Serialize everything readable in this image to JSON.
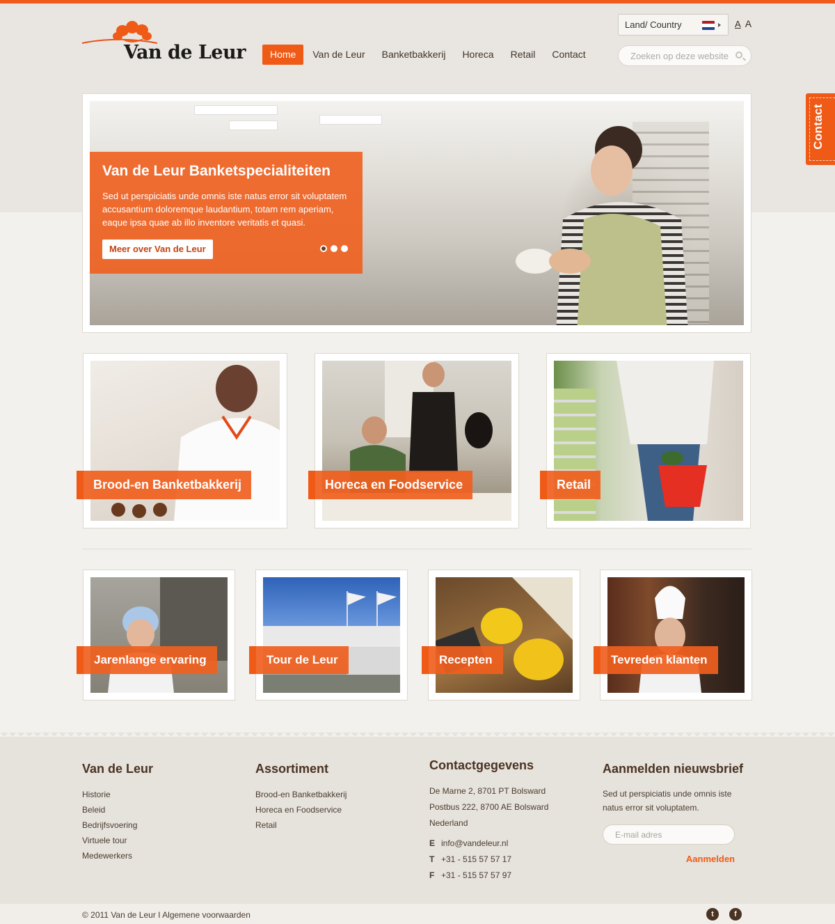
{
  "colors": {
    "accent": "#ef5a17",
    "brown": "#4a3322"
  },
  "header": {
    "logo_text": "Van de Leur",
    "country_label": "Land/ Country",
    "font_small": "A",
    "font_large": "A",
    "search_placeholder": "Zoeken op deze website",
    "nav": [
      {
        "label": "Home",
        "active": true
      },
      {
        "label": "Van de Leur"
      },
      {
        "label": "Banketbakkerij"
      },
      {
        "label": "Horeca"
      },
      {
        "label": "Retail"
      },
      {
        "label": "Contact"
      }
    ]
  },
  "side_tab": {
    "label": "Contact"
  },
  "hero": {
    "title": "Van de Leur Banketspecialiteiten",
    "text": "Sed ut perspiciatis unde omnis iste natus error sit voluptatem accusantium doloremque laudantium, totam rem aperiam, eaque ipsa quae ab illo inventore veritatis et quasi.",
    "button": "Meer over Van de Leur",
    "slides": 3,
    "active_slide": 1
  },
  "main_cards": [
    {
      "label": "Brood-en Banketbakkerij"
    },
    {
      "label": "Horeca en Foodservice"
    },
    {
      "label": "Retail"
    }
  ],
  "small_cards": [
    {
      "label": "Jarenlange ervaring"
    },
    {
      "label": "Tour de Leur"
    },
    {
      "label": "Recepten"
    },
    {
      "label": "Tevreden klanten"
    }
  ],
  "footer": {
    "col1": {
      "title": "Van de Leur",
      "links": [
        "Historie",
        "Beleid",
        "Bedrijfsvoering",
        "Virtuele tour",
        "Medewerkers"
      ]
    },
    "col2": {
      "title": "Assortiment",
      "links": [
        "Brood-en Banketbakkerij",
        "Horeca en Foodservice",
        "Retail"
      ]
    },
    "col3": {
      "title": "Contactgegevens",
      "address": [
        "De Marne 2, 8701 PT Bolsward",
        "Postbus 222, 8700 AE Bolsward",
        "Nederland"
      ],
      "email_key": "E",
      "email": "info@vandeleur.nl",
      "phone_key": "T",
      "phone": "+31 - 515 57 57 17",
      "fax_key": "F",
      "fax": "+31 - 515 57 57 97"
    },
    "col4": {
      "title": "Aanmelden nieuwsbrief",
      "intro": "Sed ut perspiciatis unde omnis iste natus error sit voluptatem.",
      "email_placeholder": "E-mail adres",
      "button": "Aanmelden"
    }
  },
  "bottom": {
    "copyright": "© 2011 Van de Leur I Algemene voorwaarden",
    "twitter_icon": "t",
    "facebook_icon": "f"
  }
}
